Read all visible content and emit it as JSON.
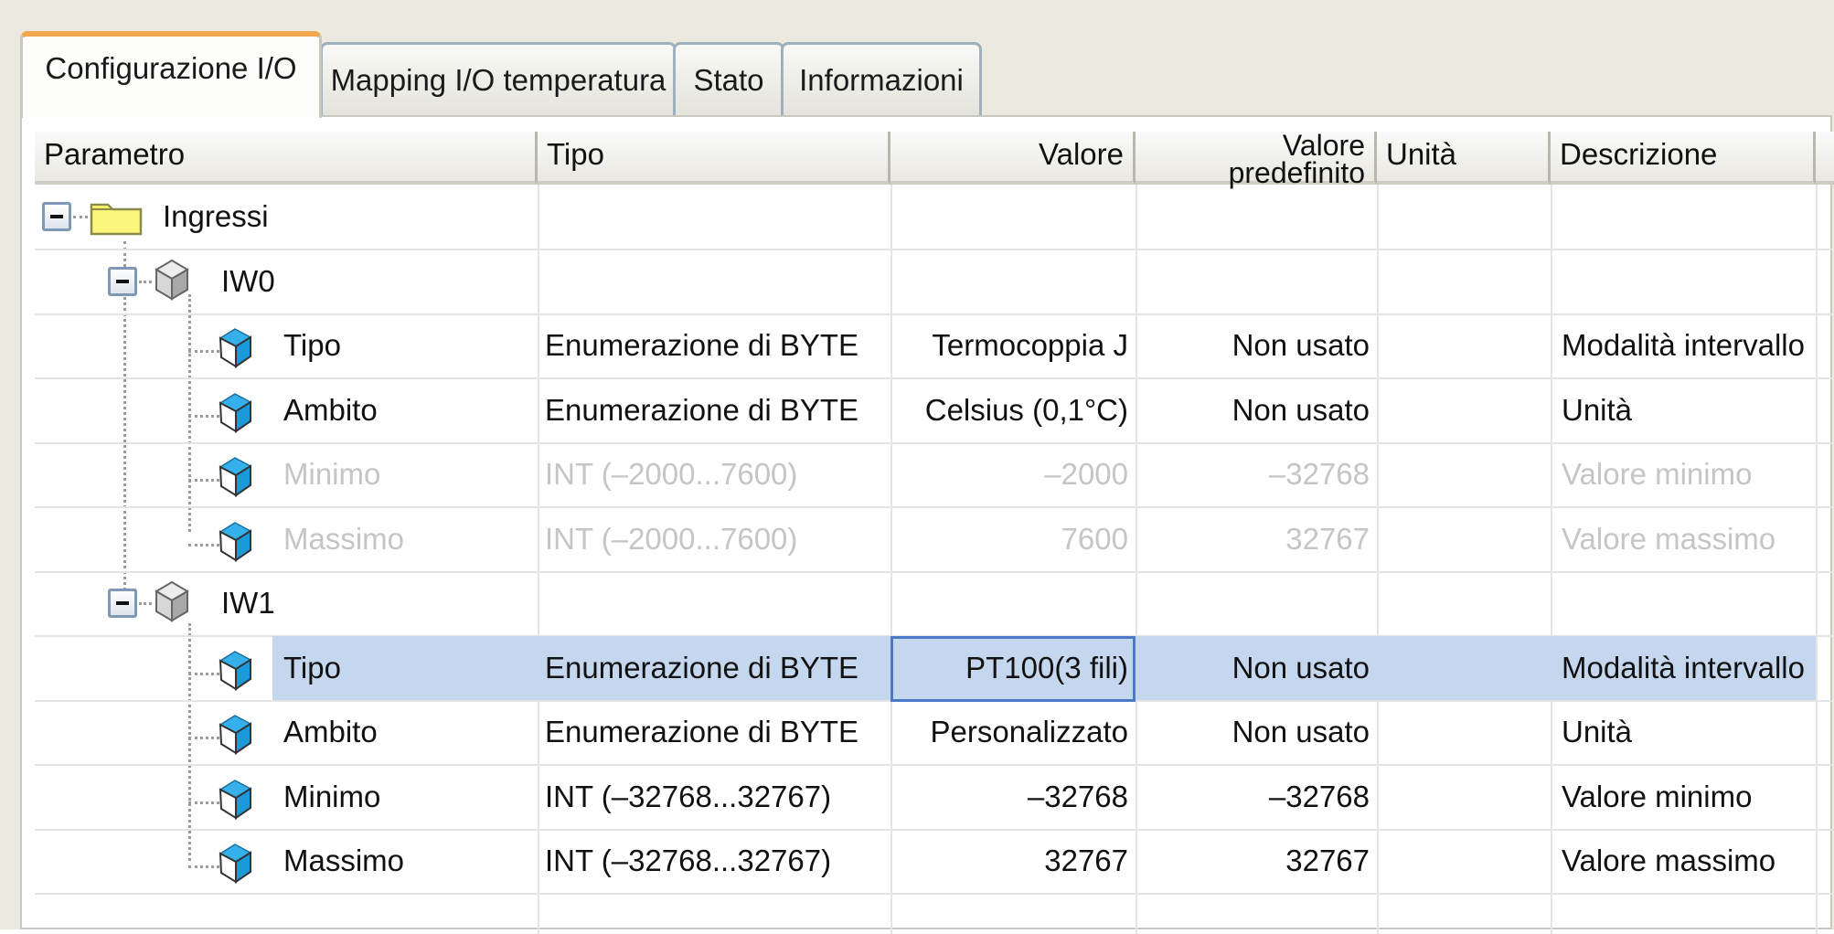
{
  "tabs": [
    {
      "label": "Configurazione I/O",
      "active": true
    },
    {
      "label": "Mapping I/O temperatura"
    },
    {
      "label": "Stato"
    },
    {
      "label": "Informazioni"
    }
  ],
  "columns": {
    "parametro": "Parametro",
    "tipo": "Tipo",
    "valore": "Valore",
    "predef_1": "Valore",
    "predef_2": "predefinito",
    "unita": "Unità",
    "descrizione": "Descrizione"
  },
  "rows": [
    {
      "name": "Ingressi",
      "icon": "folder-icon",
      "tipo": "",
      "valore": "",
      "predefinito": "",
      "unita": "",
      "descrizione": ""
    },
    {
      "name": "IW0",
      "icon": "channel-cube-icon",
      "tipo": "",
      "valore": "",
      "predefinito": "",
      "unita": "",
      "descrizione": ""
    },
    {
      "name": "Tipo",
      "icon": "parameter-cube-icon",
      "tipo": "Enumerazione di BYTE",
      "valore": "Termocoppia J",
      "predefinito": "Non usato",
      "unita": "",
      "descrizione": "Modalità intervallo"
    },
    {
      "name": "Ambito",
      "icon": "parameter-cube-icon",
      "tipo": "Enumerazione di BYTE",
      "valore": "Celsius (0,1°C)",
      "predefinito": "Non usato",
      "unita": "",
      "descrizione": "Unità"
    },
    {
      "name": "Minimo",
      "icon": "parameter-cube-icon",
      "tipo": "INT (–2000...7600)",
      "valore": "–2000",
      "predefinito": "–32768",
      "unita": "",
      "descrizione": "Valore minimo",
      "disabled": true
    },
    {
      "name": "Massimo",
      "icon": "parameter-cube-icon",
      "tipo": "INT (–2000...7600)",
      "valore": "7600",
      "predefinito": "32767",
      "unita": "",
      "descrizione": "Valore massimo",
      "disabled": true
    },
    {
      "name": "IW1",
      "icon": "channel-cube-icon",
      "tipo": "",
      "valore": "",
      "predefinito": "",
      "unita": "",
      "descrizione": ""
    },
    {
      "name": "Tipo",
      "icon": "parameter-cube-icon",
      "tipo": "Enumerazione di BYTE",
      "valore": "PT100(3 fili)",
      "predefinito": "Non usato",
      "unita": "",
      "descrizione": "Modalità intervallo",
      "selected": true
    },
    {
      "name": "Ambito",
      "icon": "parameter-cube-icon",
      "tipo": "Enumerazione di BYTE",
      "valore": "Personalizzato",
      "predefinito": "Non usato",
      "unita": "",
      "descrizione": "Unità"
    },
    {
      "name": "Minimo",
      "icon": "parameter-cube-icon",
      "tipo": "INT (–32768...32767)",
      "valore": "–32768",
      "predefinito": "–32768",
      "unita": "",
      "descrizione": "Valore minimo"
    },
    {
      "name": "Massimo",
      "icon": "parameter-cube-icon",
      "tipo": "INT (–32768...32767)",
      "valore": "32767",
      "predefinito": "32767",
      "unita": "",
      "descrizione": "Valore massimo"
    }
  ],
  "colors": {
    "selection": "#c5d7ef",
    "selection_border": "#4c7ac9",
    "tab_accent": "#f0a84e",
    "disabled_text": "#c5c5c5"
  }
}
